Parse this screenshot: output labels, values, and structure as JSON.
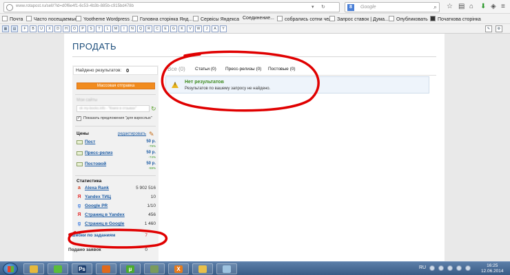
{
  "browser": {
    "url": "www.rotapost.ru/sell/?id=d0f6e4f1-6c53-4b3b-885b-c915bd478b",
    "search_engine_badge": "8",
    "search_placeholder": "Google",
    "bookmarks": [
      {
        "label": "Почта"
      },
      {
        "label": "Часто посещаемые"
      },
      {
        "label": "Yootheme Wordpress ..."
      },
      {
        "label": "Головна сторінка Янд..."
      },
      {
        "label": "Сервісы Яндекса"
      },
      {
        "label": "Соединение..."
      },
      {
        "label": "собрались сотни чел..."
      },
      {
        "label": "Запрос ставок | Дума..."
      },
      {
        "label": "Опубликовать"
      },
      {
        "label": "Початкова сторінка"
      }
    ],
    "toolbar_icons": [
      "star-icon",
      "clipboard-icon",
      "home-icon",
      "download-icon",
      "shield-icon",
      "menu-icon"
    ],
    "extension_labels": [
      "F",
      "B",
      "U",
      "X",
      "D",
      "H",
      "O",
      "P",
      "S",
      "T",
      "L",
      "M",
      "I",
      "N",
      "Q",
      "R",
      "C",
      "E",
      "G",
      "K",
      "V",
      "W",
      "J",
      "A",
      "Y"
    ]
  },
  "page": {
    "title": "ПРОДАТЬ"
  },
  "sidebar": {
    "found_label": "Найдено результатов:",
    "found_count": "0",
    "mass_send_button": "Массовая отправка",
    "sites_label": "Мои сайты",
    "sites_selected": "ok my-books.info - \"Книги в отзывах\"",
    "adult_checkbox_label": "Показать предложения \"для взрослых\"",
    "adult_checked": true,
    "prices_heading": "Цены",
    "edit_link": "редактировать",
    "prices": [
      {
        "name": "Пост",
        "price": "50 р.",
        "pct": "-79%"
      },
      {
        "name": "Пресс-релиз",
        "price": "50 р.",
        "pct": "-74%"
      },
      {
        "name": "Постовой",
        "price": "50 р.",
        "pct": "-59%"
      }
    ],
    "stats_heading": "Статистика",
    "stats": [
      {
        "name": "Alexa Rank",
        "value": "5 902 516",
        "icon": "alexa-icon",
        "icon_char": "a",
        "color": "#d23b1e"
      },
      {
        "name": "Yandex ТИЦ",
        "value": "10",
        "icon": "yandex-icon",
        "icon_char": "Я",
        "color": "#e62e2e"
      },
      {
        "name": "Google PR",
        "value": "1/10",
        "icon": "google-icon",
        "icon_char": "g",
        "color": "#3b7be0"
      },
      {
        "name": "Страниц в Yandex",
        "value": "456",
        "icon": "yandex-icon",
        "icon_char": "Я",
        "color": "#e62e2e"
      },
      {
        "name": "Страниц в Google",
        "value": "1 460",
        "icon": "google-icon",
        "icon_char": "g",
        "color": "#3b7be0"
      }
    ],
    "errors_label": "Ошибки по заданиям",
    "errors_count": "7",
    "orders_label": "Подано заявок",
    "orders_count": "0"
  },
  "main": {
    "tabs": [
      {
        "label": "Все (0)",
        "active": true
      },
      {
        "label": "Статьи (0)",
        "active": false
      },
      {
        "label": "Пресс-релизы (0)",
        "active": false
      },
      {
        "label": "Постовые (0)",
        "active": false
      }
    ],
    "alert_title": "Нет результатов",
    "alert_message": "Результатов по вашему запросу не найдено."
  },
  "taskbar": {
    "apps": [
      "explorer-icon",
      "icq-icon",
      "photoshop-icon",
      "firefox-icon",
      "utorrent-icon",
      "notepad-icon",
      "xampp-icon",
      "paint-icon",
      "window-icon"
    ],
    "app_letters": [
      "",
      "",
      "Ps",
      "",
      "µ",
      "",
      "X",
      "",
      ""
    ],
    "language": "RU",
    "time": "16:25",
    "date": "12.06.2014"
  },
  "colors": {
    "accent_orange": "#f18b1e",
    "link_blue": "#1a5aa3",
    "annotation_red": "#e00000",
    "success_green": "#3d8b1f"
  }
}
